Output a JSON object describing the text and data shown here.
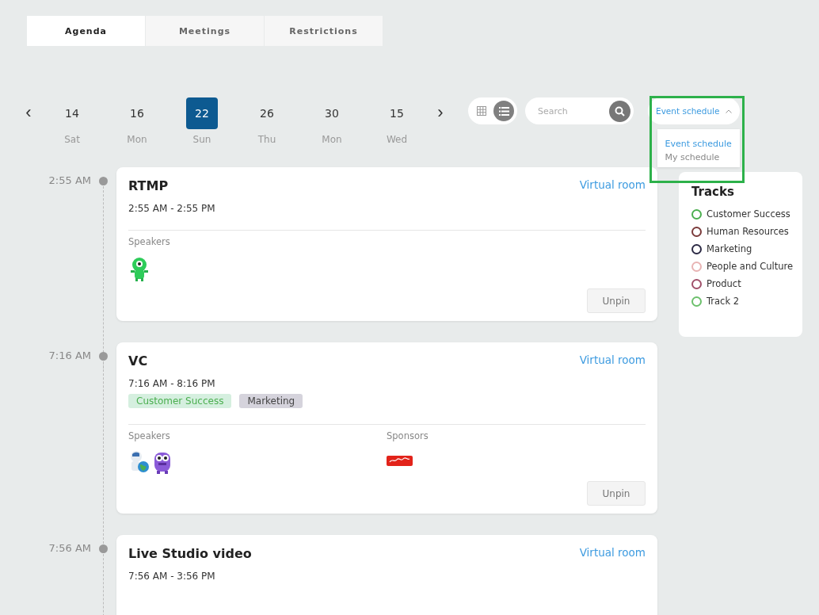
{
  "tabs": [
    {
      "label": "Agenda",
      "selected": true
    },
    {
      "label": "Meetings",
      "selected": false
    },
    {
      "label": "Restrictions",
      "selected": false
    }
  ],
  "date_nav": {
    "prev": "‹",
    "next": "›",
    "dates": [
      {
        "day": "14",
        "weekday": "Sat",
        "selected": false
      },
      {
        "day": "16",
        "weekday": "Mon",
        "selected": false
      },
      {
        "day": "22",
        "weekday": "Sun",
        "selected": true
      },
      {
        "day": "26",
        "weekday": "Thu",
        "selected": false
      },
      {
        "day": "30",
        "weekday": "Mon",
        "selected": false
      },
      {
        "day": "15",
        "weekday": "Wed",
        "selected": false
      }
    ]
  },
  "view_toggle": [
    {
      "kind": "grid",
      "selected": false
    },
    {
      "kind": "list",
      "selected": true
    }
  ],
  "search": {
    "placeholder": "Search"
  },
  "schedule_dropdown": {
    "value": "Event schedule",
    "expanded": true,
    "options": [
      {
        "label": "Event schedule",
        "selected": true
      },
      {
        "label": "My schedule",
        "selected": false
      }
    ]
  },
  "sessions": [
    {
      "time": "2:55 AM",
      "title": "RTMP",
      "range": "2:55 AM - 2:55 PM",
      "link": "Virtual room",
      "speakers_label": "Speakers",
      "speakers": [
        {
          "kind": "alien"
        }
      ],
      "button": "Unpin"
    },
    {
      "time": "7:16 AM",
      "title": "VC",
      "range": "7:16 AM - 8:16 PM",
      "link": "Virtual room",
      "tags": [
        {
          "label": "Customer Success",
          "color": "#d5efdf"
        },
        {
          "label": "Marketing",
          "color": "#d5d3dc"
        }
      ],
      "speakers_label": "Speakers",
      "speakers": [
        {
          "kind": "astronaut"
        },
        {
          "kind": "monster"
        }
      ],
      "sponsors_label": "Sponsors",
      "sponsors": [
        {
          "kind": "logo"
        }
      ],
      "button": "Unpin"
    },
    {
      "time": "7:56 AM",
      "title": "Live Studio video",
      "range": "7:56 AM - 3:56 PM",
      "link": "Virtual room"
    }
  ],
  "tracks": {
    "title": "Tracks",
    "items": [
      {
        "label": "Customer Success",
        "color": "#4caf50"
      },
      {
        "label": "Human Resources",
        "color": "#7b3b3b"
      },
      {
        "label": "Marketing",
        "color": "#2c2a45"
      },
      {
        "label": "People and Culture",
        "color": "#e8b4b4"
      },
      {
        "label": "Product",
        "color": "#a0506a"
      },
      {
        "label": "Track 2",
        "color": "#6cc06c"
      }
    ]
  }
}
